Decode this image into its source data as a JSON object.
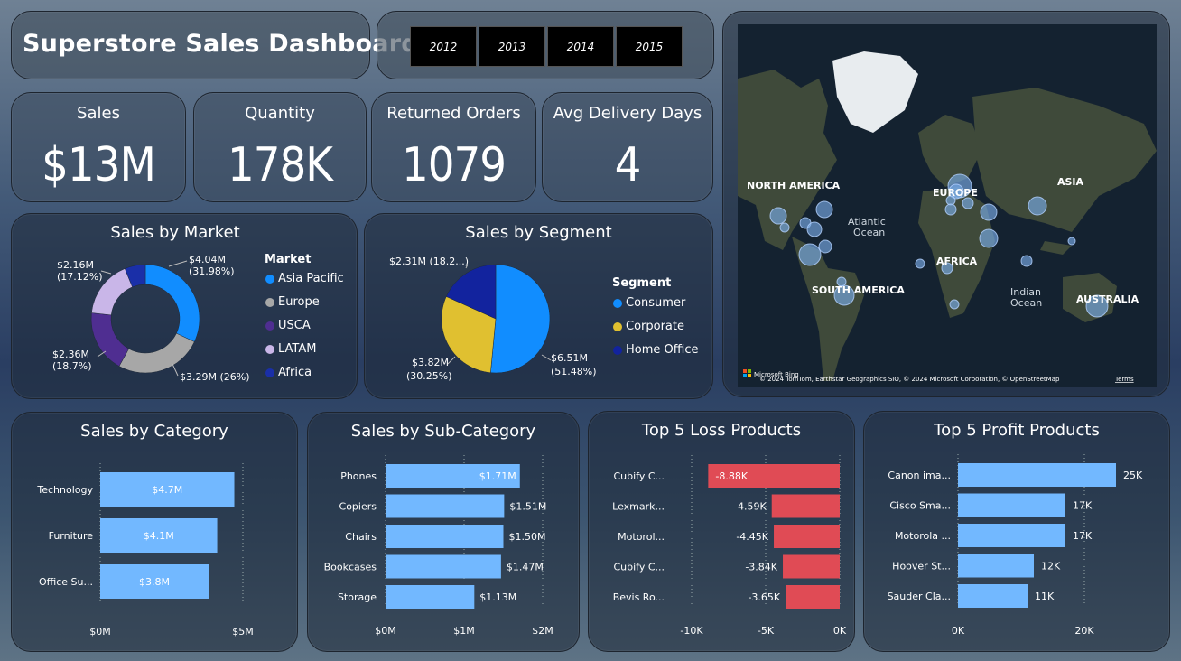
{
  "header": {
    "title": "Superstore Sales Dashboard"
  },
  "years": [
    "2012",
    "2013",
    "2014",
    "2015"
  ],
  "kpis": {
    "sales": {
      "label": "Sales",
      "value": "$13M"
    },
    "quantity": {
      "label": "Quantity",
      "value": "178K"
    },
    "returned": {
      "label": "Returned Orders",
      "value": "1079"
    },
    "delivery": {
      "label": "Avg Delivery Days",
      "value": "4"
    }
  },
  "market": {
    "title": "Sales by Market",
    "legend_title": "Market",
    "items": [
      {
        "name": "Asia Pacific",
        "label1": "$4.04M",
        "label2": "(31.98%)",
        "color": "#118dff"
      },
      {
        "name": "Europe",
        "label1": "$3.29M (26%)",
        "label2": "",
        "color": "#a7a7a7"
      },
      {
        "name": "USCA",
        "label1": "$2.36M",
        "label2": "(18.7%)",
        "color": "#4f2e91"
      },
      {
        "name": "LATAM",
        "label1": "$2.16M",
        "label2": "(17.12%)",
        "color": "#c9b6e8"
      },
      {
        "name": "Africa",
        "label1": "",
        "label2": "",
        "color": "#1a2fa8"
      }
    ]
  },
  "segment": {
    "title": "Sales by Segment",
    "legend_title": "Segment",
    "items": [
      {
        "name": "Consumer",
        "label1": "$6.51M",
        "label2": "(51.48%)",
        "color": "#118dff"
      },
      {
        "name": "Corporate",
        "label1": "$3.82M",
        "label2": "(30.25%)",
        "color": "#e0c030"
      },
      {
        "name": "Home Office",
        "label1": "$2.31M (18.2...)",
        "label2": "",
        "color": "#12239e"
      }
    ]
  },
  "map": {
    "labels": {
      "north_america": "NORTH AMERICA",
      "europe": "EUROPE",
      "asia": "ASIA",
      "africa": "AFRICA",
      "south_america": "SOUTH AMERICA",
      "australia": "AUSTRALIA",
      "atlantic1": "Atlantic",
      "atlantic2": "Ocean",
      "indian1": "Indian",
      "indian2": "Ocean"
    },
    "attribution": "© 2024 TomTom, Earthstar Geographics SIO, © 2024 Microsoft Corporation, © OpenStreetMap",
    "terms": "Terms",
    "bing": "Microsoft Bing"
  },
  "category": {
    "title": "Sales by Category",
    "rows": [
      {
        "name": "Technology",
        "label": "$4.7M",
        "value": 4.7
      },
      {
        "name": "Furniture",
        "label": "$4.1M",
        "value": 4.1
      },
      {
        "name": "Office Su...",
        "label": "$3.8M",
        "value": 3.8
      }
    ],
    "ticks": [
      "$0M",
      "$5M"
    ]
  },
  "subcategory": {
    "title": "Sales by Sub-Category",
    "rows": [
      {
        "name": "Phones",
        "label": "$1.71M",
        "value": 1.71
      },
      {
        "name": "Copiers",
        "label": "$1.51M",
        "value": 1.51
      },
      {
        "name": "Chairs",
        "label": "$1.50M",
        "value": 1.5
      },
      {
        "name": "Bookcases",
        "label": "$1.47M",
        "value": 1.47
      },
      {
        "name": "Storage",
        "label": "$1.13M",
        "value": 1.13
      }
    ],
    "ticks": [
      "$0M",
      "$1M",
      "$2M"
    ]
  },
  "loss": {
    "title": "Top 5 Loss Products",
    "rows": [
      {
        "name": "Cubify C...",
        "label": "-8.88K",
        "value": -8.88
      },
      {
        "name": "Lexmark...",
        "label": "-4.59K",
        "value": -4.59
      },
      {
        "name": "Motorol...",
        "label": "-4.45K",
        "value": -4.45
      },
      {
        "name": "Cubify C...",
        "label": "-3.84K",
        "value": -3.84
      },
      {
        "name": "Bevis Ro...",
        "label": "-3.65K",
        "value": -3.65
      }
    ],
    "ticks": [
      "-10K",
      "-5K",
      "0K"
    ]
  },
  "profit": {
    "title": "Top 5 Profit Products",
    "rows": [
      {
        "name": "Canon ima...",
        "label": "25K",
        "value": 25
      },
      {
        "name": "Cisco Sma...",
        "label": "17K",
        "value": 17
      },
      {
        "name": "Motorola ...",
        "label": "17K",
        "value": 17
      },
      {
        "name": "Hoover St...",
        "label": "12K",
        "value": 12
      },
      {
        "name": "Sauder Cla...",
        "label": "11K",
        "value": 11
      }
    ],
    "ticks": [
      "0K",
      "20K"
    ]
  },
  "chart_data": [
    {
      "type": "pie",
      "title": "Sales by Market",
      "categories": [
        "Asia Pacific",
        "Europe",
        "USCA",
        "LATAM",
        "Africa"
      ],
      "values": [
        4.04,
        3.29,
        2.36,
        2.16,
        0.78
      ]
    },
    {
      "type": "pie",
      "title": "Sales by Segment",
      "categories": [
        "Consumer",
        "Corporate",
        "Home Office"
      ],
      "values": [
        6.51,
        3.82,
        2.31
      ]
    },
    {
      "type": "bar",
      "title": "Sales by Category",
      "categories": [
        "Technology",
        "Furniture",
        "Office Su..."
      ],
      "values": [
        4.7,
        4.1,
        3.8
      ]
    },
    {
      "type": "bar",
      "title": "Sales by Sub-Category",
      "categories": [
        "Phones",
        "Copiers",
        "Chairs",
        "Bookcases",
        "Storage"
      ],
      "values": [
        1.71,
        1.51,
        1.5,
        1.47,
        1.13
      ]
    },
    {
      "type": "bar",
      "title": "Top 5 Loss Products",
      "categories": [
        "Cubify C...",
        "Lexmark...",
        "Motorol...",
        "Cubify C...",
        "Bevis Ro..."
      ],
      "values": [
        -8.88,
        -4.59,
        -4.45,
        -3.84,
        -3.65
      ]
    },
    {
      "type": "bar",
      "title": "Top 5 Profit Products",
      "categories": [
        "Canon ima...",
        "Cisco Sma...",
        "Motorola ...",
        "Hoover St...",
        "Sauder Cla..."
      ],
      "values": [
        25,
        17,
        17,
        12,
        11
      ]
    }
  ]
}
